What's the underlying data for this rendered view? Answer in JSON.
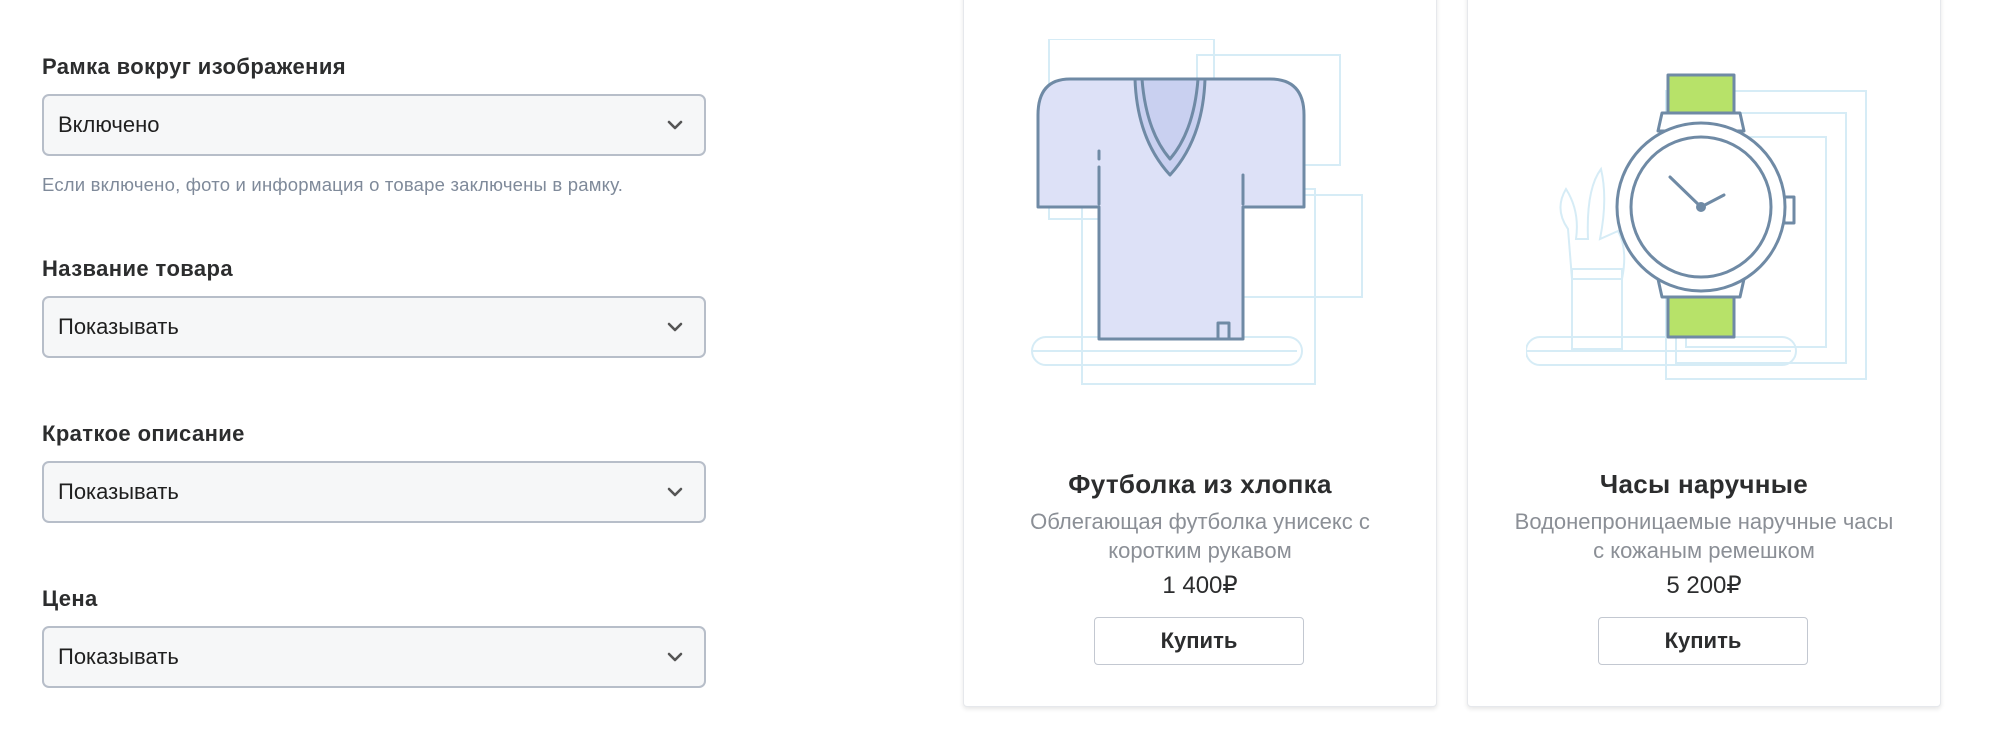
{
  "settings": {
    "frame": {
      "label": "Рамка вокруг изображения",
      "value": "Включено",
      "hint": "Если включено, фото и информация о товаре заключены в рамку."
    },
    "product_name": {
      "label": "Название товара",
      "value": "Показывать"
    },
    "short_description": {
      "label": "Краткое описание",
      "value": "Показывать"
    },
    "price": {
      "label": "Цена",
      "value": "Показывать"
    }
  },
  "products": [
    {
      "icon": "t-shirt-illustration",
      "title": "Футболка из хлопка",
      "description": "Облегающая футболка унисекс с коротким рукавом",
      "price": "1 400₽",
      "button": "Купить"
    },
    {
      "icon": "wristwatch-illustration",
      "title": "Часы наручные",
      "description": "Водонепроницаемые наручные часы с кожаным ремешком",
      "price": "5 200₽",
      "button": "Купить"
    }
  ],
  "colors": {
    "shirt_fill": "#dde1f7",
    "shirt_collar": "#c9d0f0",
    "outline": "#6f8aa5",
    "strap_green": "#b7e269",
    "bg_lines": "#d6ecf6"
  }
}
